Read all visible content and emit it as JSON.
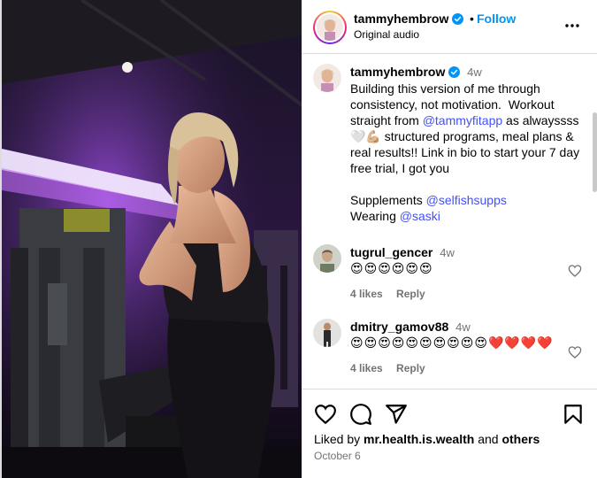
{
  "post": {
    "username": "tammyhembrow",
    "separator": "•",
    "follow_label": "Follow",
    "audio": "Original audio",
    "verified": true
  },
  "caption": {
    "username": "tammyhembrow",
    "time": "4w",
    "line1": "Building this version of me through consistency, not motivation.  Workout straight from ",
    "mention1": "@tammyfitapp",
    "line2": " as alwayssss🤍💪🏼 structured programs, meal plans & real results!! Link in bio to start your 7 day free trial, I got you",
    "supplements_label": "Supplements ",
    "mention2": "@selfishsupps",
    "wearing_label": "Wearing ",
    "mention3": "@saski"
  },
  "comments": [
    {
      "username": "tugrul_gencer",
      "time": "4w",
      "text": "😍😍😍😍😍😍",
      "likes": "4 likes",
      "reply_label": "Reply"
    },
    {
      "username": "dmitry_gamov88",
      "time": "4w",
      "text": "😍😍😍😍😍😍😍😍😍😍❤️❤️❤️❤️",
      "likes": "4 likes",
      "reply_label": "Reply"
    }
  ],
  "footer": {
    "liked_prefix": "Liked by ",
    "liked_user": "mr.health.is.wealth",
    "liked_and": " and ",
    "liked_others": "others",
    "date": "October 6"
  },
  "colors": {
    "link": "#0095f6",
    "mention": "#4150f7",
    "verified": "#0095f6",
    "secondary_text": "#737373",
    "divider": "#dbdbdb"
  },
  "icons": [
    "verified-badge-icon",
    "more-options-icon",
    "heart-icon",
    "comment-icon",
    "share-icon",
    "bookmark-icon"
  ]
}
